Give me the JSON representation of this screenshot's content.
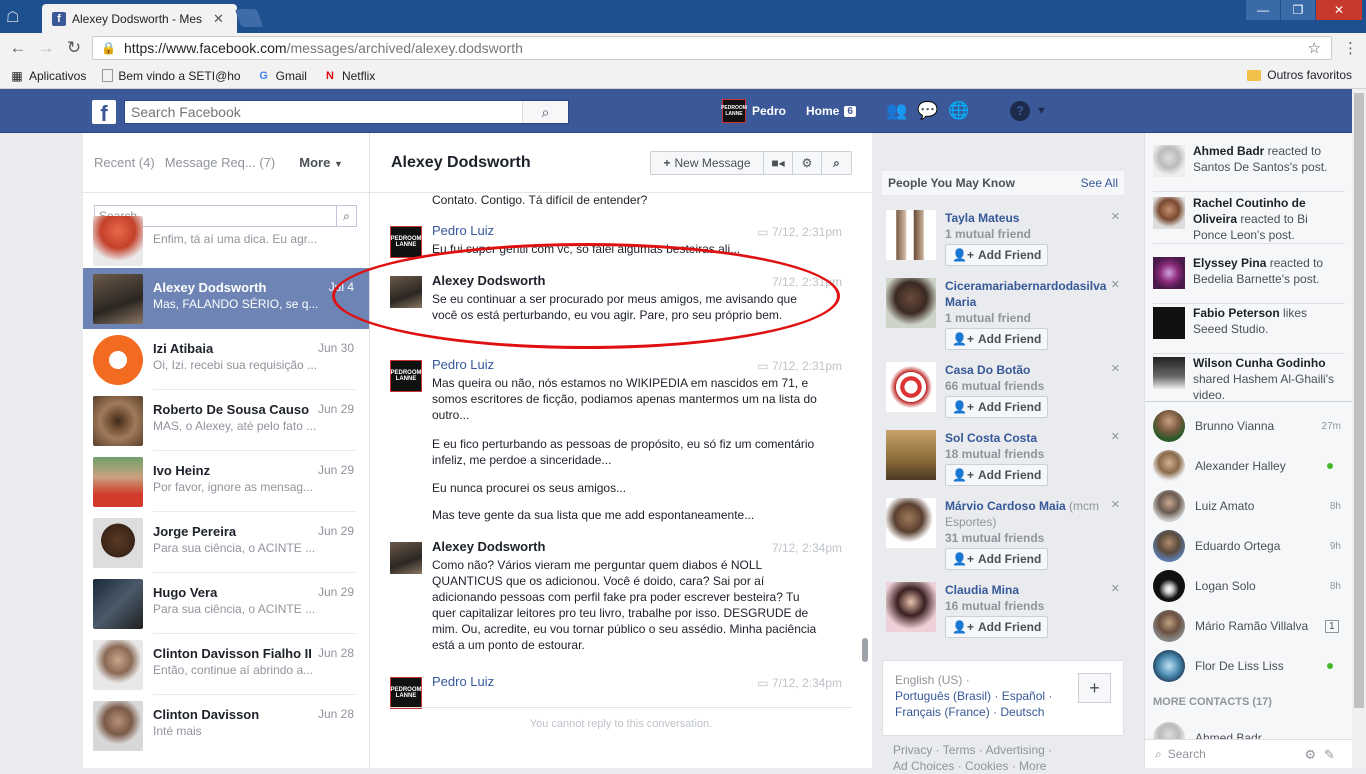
{
  "browser": {
    "tab_title": "Alexey Dodsworth - Mes",
    "url_host": "https://www.facebook.com",
    "url_path": "/messages/archived/alexey.dodsworth",
    "bookmarks": [
      "Aplicativos",
      "Bem vindo a SETI@ho",
      "Gmail",
      "Netflix"
    ],
    "other_bookmarks": "Outros favoritos"
  },
  "fb_header": {
    "search_placeholder": "Search Facebook",
    "user_name": "Pedro",
    "home_label": "Home",
    "home_count": "6",
    "avatar_text": "PEDROOM LANNE"
  },
  "threads": {
    "tabs": {
      "recent": "Recent (4)",
      "requests": "Message Req... (7)",
      "more": "More"
    },
    "search_placeholder": "Search",
    "items": [
      {
        "name": "",
        "date": "",
        "preview": "Enfim, tá aí uma dica. Eu agr..."
      },
      {
        "name": "Alexey Dodsworth",
        "date": "Jul 4",
        "preview": "Mas, FALANDO SÉRIO, se q..."
      },
      {
        "name": "Izi Atibaia",
        "date": "Jun 30",
        "preview": "Oi, Izi. recebi sua requisição ..."
      },
      {
        "name": "Roberto De Sousa Causo",
        "date": "Jun 29",
        "preview": "MAS, o Alexey, até pelo fato ..."
      },
      {
        "name": "Ivo Heinz",
        "date": "Jun 29",
        "preview": "Por favor, ignore as mensag..."
      },
      {
        "name": "Jorge Pereira",
        "date": "Jun 29",
        "preview": "Para sua ciência, o ACINTE ..."
      },
      {
        "name": "Hugo Vera",
        "date": "Jun 29",
        "preview": "Para sua ciência, o ACINTE ..."
      },
      {
        "name": "Clinton Davisson Fialho II",
        "date": "Jun 28",
        "preview": "Então, continue aí abrindo a..."
      },
      {
        "name": "Clinton Davisson",
        "date": "Jun 28",
        "preview": "Inté mais"
      }
    ]
  },
  "conversation": {
    "title": "Alexey Dodsworth",
    "new_message": "New Message",
    "top_fragment": "Contato. Contigo. Tá difícil de entender?",
    "messages": [
      {
        "sender": "Pedro Luiz",
        "time": "7/12, 2:31pm",
        "lines": [
          "Eu fui super gentil com vc, só falei algumas besteiras ali..."
        ]
      },
      {
        "sender": "Alexey Dodsworth",
        "time": "7/12, 2:31pm",
        "lines": [
          "Se eu continuar a ser procurado por meus amigos, me avisando que você os está perturbando, eu vou agir. Pare, pro seu próprio bem."
        ]
      },
      {
        "sender": "Pedro Luiz",
        "time": "7/12, 2:31pm",
        "lines": [
          "Mas queira ou não, nós estamos no WIKIPEDIA em nascidos em 71, e somos escritores de ficção, podiamos apenas mantermos um na lista do outro...",
          "E eu fico perturbando as pessoas de propósito, eu só fiz um comentário infeliz, me perdoe a sinceridade...",
          "Eu nunca procurei os seus amigos...",
          "Mas teve gente da sua lista que me add espontaneamente..."
        ]
      },
      {
        "sender": "Alexey Dodsworth",
        "time": "7/12, 2:34pm",
        "lines": [
          "Como não? Vários vieram me perguntar quem diabos é NOLL QUANTICUS que os adicionou. Você é doido, cara? Sai por aí adicionando pessoas com perfil fake pra poder escrever besteira? Tu quer capitalizar leitores pro teu livro, trabalhe por isso. DESGRUDE de mim. Ou, acredite, eu vou tornar público o seu assédio. Minha paciência está a um ponto de estourar."
        ]
      },
      {
        "sender": "Pedro Luiz",
        "time": "7/12, 2:34pm",
        "lines": [
          ""
        ]
      }
    ],
    "no_reply": "You cannot reply to this conversation."
  },
  "pymk": {
    "title": "People You May Know",
    "see_all": "See All",
    "add_friend": "Add Friend",
    "people": [
      {
        "name": "Tayla Mateus",
        "note": "",
        "mutual": "1 mutual friend"
      },
      {
        "name": "Ciceramariabernardodasilva Maria",
        "note": "",
        "mutual": "1 mutual friend"
      },
      {
        "name": "Casa Do Botão",
        "note": "",
        "mutual": "66 mutual friends"
      },
      {
        "name": "Sol Costa Costa",
        "note": "",
        "mutual": "18 mutual friends"
      },
      {
        "name": "Márvio Cardoso Maia",
        "note": "(mcm Esportes)",
        "mutual": "31 mutual friends"
      },
      {
        "name": "Claudia Mina",
        "note": "",
        "mutual": "16 mutual friends"
      }
    ]
  },
  "languages": {
    "current": "English (US) ·",
    "line2": "Português (Brasil) · Español ·",
    "line3": "Français (France) · Deutsch"
  },
  "footer": {
    "line1": "Privacy · Terms · Advertising ·",
    "line2": "Ad Choices · Cookies · More"
  },
  "ticker": [
    {
      "name": "Ahmed Badr",
      "rest": " reacted to Santos De Santos's post."
    },
    {
      "name": "Rachel Coutinho de Oliveira",
      "rest": " reacted to Bi Ponce Leon's post."
    },
    {
      "name": "Elyssey Pina",
      "rest": " reacted to Bedelia Barnette's post."
    },
    {
      "name": "Fabio Peterson",
      "rest": " likes Seeed Studio."
    },
    {
      "name": "Wilson Cunha Godinho",
      "rest": " shared Hashem Al-Ghaili's video."
    }
  ],
  "chat": {
    "contacts": [
      {
        "name": "Brunno Vianna",
        "status": "27m"
      },
      {
        "name": "Alexander Halley",
        "status": ""
      },
      {
        "name": "Luiz Amato",
        "status": "8h"
      },
      {
        "name": "Eduardo Ortega",
        "status": "9h"
      },
      {
        "name": "Logan Solo",
        "status": "8h"
      },
      {
        "name": "Mário Ramão Villalva",
        "status": "1"
      },
      {
        "name": "Flor De Liss Liss",
        "status": ""
      }
    ],
    "more_contacts": "MORE CONTACTS (17)",
    "more_first": "Ahmed Badr",
    "search_placeholder": "Search"
  },
  "colors": {
    "fb_blue": "#3b5998",
    "selected_thread": "#6d84b4",
    "annotation_red": "#e01010",
    "online": "#42b72a"
  }
}
